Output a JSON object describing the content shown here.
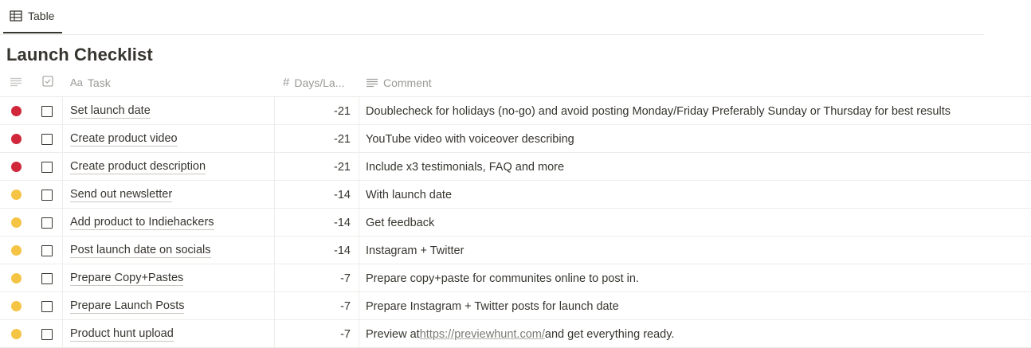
{
  "view_tab": {
    "label": "Table",
    "icon": "table-icon"
  },
  "page_title": "Launch Checklist",
  "columns": {
    "status": {
      "icon": "lines-icon"
    },
    "done": {
      "icon": "checkbox-icon"
    },
    "task": {
      "prefix": "Aa",
      "label": "Task"
    },
    "days": {
      "prefix": "#",
      "label": "Days/La..."
    },
    "comment": {
      "icon": "text-lines-icon",
      "label": "Comment"
    }
  },
  "colors": {
    "red": "#d1273b",
    "yellow": "#f6c445"
  },
  "rows": [
    {
      "status": "red",
      "task": "Set launch date",
      "days": "-21",
      "comment": "Doublecheck for holidays (no-go) and avoid posting Monday/Friday Preferably Sunday or Thursday for best results"
    },
    {
      "status": "red",
      "task": "Create product video",
      "days": "-21",
      "comment": "YouTube video with voiceover describing"
    },
    {
      "status": "red",
      "task": "Create product description",
      "days": "-21",
      "comment": "Include x3 testimonials, FAQ and more"
    },
    {
      "status": "yellow",
      "task": "Send out newsletter",
      "days": "-14",
      "comment": "With launch date"
    },
    {
      "status": "yellow",
      "task": "Add product to Indiehackers",
      "days": "-14",
      "comment": "Get feedback"
    },
    {
      "status": "yellow",
      "task": "Post launch date on socials",
      "days": "-14",
      "comment": "Instagram + Twitter"
    },
    {
      "status": "yellow",
      "task": "Prepare Copy+Pastes",
      "days": "-7",
      "comment": "Prepare copy+paste for communites online to post in."
    },
    {
      "status": "yellow",
      "task": "Prepare Launch Posts",
      "days": "-7",
      "comment": "Prepare Instagram + Twitter posts for launch date"
    },
    {
      "status": "yellow",
      "task": "Product hunt upload",
      "days": "-7",
      "comment_pre": "Preview at ",
      "comment_link": "https://previewhunt.com/",
      "comment_post": " and get everything ready."
    }
  ]
}
